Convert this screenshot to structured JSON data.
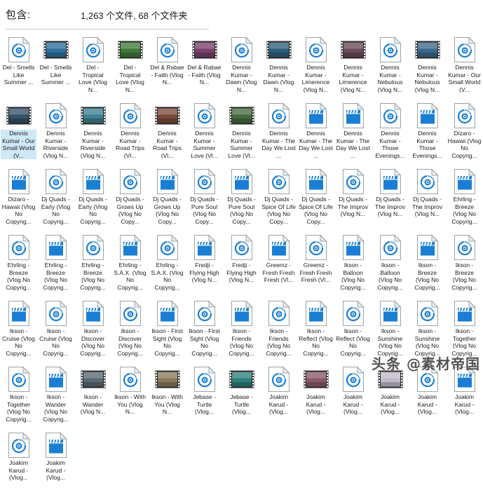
{
  "header": {
    "label": "包含:",
    "value": "1,263 个文件, 68 个文件夹"
  },
  "watermark": "头条 @素材帝国",
  "colors": {
    "accent": "#1a7fd4",
    "selection": "#cde8f7",
    "text": "#202020",
    "rule": "#c8c8c8"
  },
  "icons": {
    "audio": "audio-disc-file-icon",
    "video_thumb": "video-filmstrip-thumbnail-icon",
    "video_clapper": "video-clapperboard-file-icon"
  },
  "items": [
    {
      "name": "Del - Smells Like Summer ...",
      "icon": "audio",
      "selected": false
    },
    {
      "name": "Del - Smells Like Summer ...",
      "icon": "video_thumb",
      "thumb": "#2f6f9e",
      "selected": false
    },
    {
      "name": "Del - Tropical Love (Vlog N...",
      "icon": "audio",
      "selected": false
    },
    {
      "name": "Del - Tropical Love (Vlog N...",
      "icon": "video_thumb",
      "thumb": "#3f7a3a",
      "selected": false
    },
    {
      "name": "Del & Rabae - Faith (Vlog N...",
      "icon": "audio",
      "selected": false
    },
    {
      "name": "Del & Rabae - Faith (Vlog N...",
      "icon": "video_thumb",
      "thumb": "#7a3f6e",
      "selected": false
    },
    {
      "name": "Dennis Kumar - Dawn (Vlog N...",
      "icon": "audio",
      "selected": false
    },
    {
      "name": "Dennis Kumar - Dawn (Vlog N...",
      "icon": "video_thumb",
      "thumb": "#2d5f7a",
      "selected": false
    },
    {
      "name": "Dennis Kumar - Limerence (Vlog N...",
      "icon": "audio",
      "selected": false
    },
    {
      "name": "Dennis Kumar - Limerence (Vlog N...",
      "icon": "video_thumb",
      "thumb": "#6b4a5a",
      "selected": false
    },
    {
      "name": "Dennis Kumar - Nebulous (Vlog N...",
      "icon": "audio",
      "selected": false
    },
    {
      "name": "Dennis Kumar - Nebulous (Vlog N...",
      "icon": "video_thumb",
      "thumb": "#3a6a8a",
      "selected": false
    },
    {
      "name": "Dennis Kumar - Our Small World (V...",
      "icon": "audio",
      "selected": false
    },
    {
      "name": "Dennis Kumar - Our Small World (V...",
      "icon": "video_thumb",
      "thumb": "#35506b",
      "selected": true
    },
    {
      "name": "Dennis Kumar - Riverside (Vlog N...",
      "icon": "audio",
      "selected": false
    },
    {
      "name": "Dennis Kumar - Riverside (Vlog N...",
      "icon": "video_thumb",
      "thumb": "#3d7f93",
      "selected": false
    },
    {
      "name": "Dennis Kumar - Road Trips (Vl...",
      "icon": "audio",
      "selected": false
    },
    {
      "name": "Dennis Kumar - Road Trips (Vl...",
      "icon": "video_thumb",
      "thumb": "#7a4a38",
      "selected": false
    },
    {
      "name": "Dennis Kumar - Summer Love (Vl...",
      "icon": "audio",
      "selected": false
    },
    {
      "name": "Dennis Kumar - Summer Love (Vl...",
      "icon": "video_thumb",
      "thumb": "#456b3c",
      "selected": false
    },
    {
      "name": "Dennis Kumar - The Day We Lost ...",
      "icon": "audio",
      "selected": false
    },
    {
      "name": "Dennis Kumar - The Day We Lost ...",
      "icon": "video_clapper",
      "selected": false
    },
    {
      "name": "Dennis Kumar - The Day We Lost ...",
      "icon": "video_clapper",
      "selected": false
    },
    {
      "name": "Dennis Kumar - Those Evenings...",
      "icon": "audio",
      "selected": false
    },
    {
      "name": "Dennis Kumar - Those Evenings...",
      "icon": "video_clapper",
      "selected": false
    },
    {
      "name": "Dizaro - Hawaii (Vlog No Copyrig...",
      "icon": "audio",
      "selected": false
    },
    {
      "name": "Dizaro - Hawaii (Vlog No Copyrig...",
      "icon": "video_clapper",
      "selected": false
    },
    {
      "name": "Dj Quads - Early (Vlog No Copyrig...",
      "icon": "audio",
      "selected": false
    },
    {
      "name": "Dj Quads - Early (Vlog No Copyrig...",
      "icon": "video_clapper",
      "selected": false
    },
    {
      "name": "Dj Quads - Grows Up (Vlog No Copy...",
      "icon": "audio",
      "selected": false
    },
    {
      "name": "Dj Quads - Grows Up (Vlog No Copy...",
      "icon": "video_clapper",
      "selected": false
    },
    {
      "name": "Dj Quads - Pure Soul (Vlog No Copy...",
      "icon": "audio",
      "selected": false
    },
    {
      "name": "Dj Quads - Pure Soul (Vlog No Copy...",
      "icon": "video_clapper",
      "selected": false
    },
    {
      "name": "Dj Quads - Spice Of Life (Vlog No Copy...",
      "icon": "audio",
      "selected": false
    },
    {
      "name": "Dj Quads - Spice Of Life (Vlog No Copy...",
      "icon": "video_clapper",
      "selected": false
    },
    {
      "name": "Dj Quads - The Improv (Vlog N...",
      "icon": "audio",
      "selected": false
    },
    {
      "name": "Dj Quads - The Improv (Vlog N...",
      "icon": "video_clapper",
      "selected": false
    },
    {
      "name": "Dj Quads - The Improv (Vlog N...",
      "icon": "audio",
      "selected": false
    },
    {
      "name": "Ehrling - Breeze (Vlog No Copyrig...",
      "icon": "video_clapper",
      "selected": false
    },
    {
      "name": "Ehrling - Breeze (Vlog No Copyrig...",
      "icon": "audio",
      "selected": false
    },
    {
      "name": "Ehrling - Breeze (Vlog No Copyrig...",
      "icon": "video_clapper",
      "selected": false
    },
    {
      "name": "Ehrling - Breeze (Vlog No Copyrig...",
      "icon": "audio",
      "selected": false
    },
    {
      "name": "Ehrling - S.A.X. (Vlog No Copyrig...",
      "icon": "video_clapper",
      "selected": false
    },
    {
      "name": "Ehrling - S.A.X. (Vlog No Copyrig...",
      "icon": "audio",
      "selected": false
    },
    {
      "name": "Fredji - Flying High (Vlog N...",
      "icon": "video_clapper",
      "selected": false
    },
    {
      "name": "Fredji - Flying High (Vlog N...",
      "icon": "audio",
      "selected": false
    },
    {
      "name": "Greemz - Fresh Fresh Fresh (Vl...",
      "icon": "video_clapper",
      "selected": false
    },
    {
      "name": "Greemz - Fresh Fresh Fresh (Vl...",
      "icon": "audio",
      "selected": false
    },
    {
      "name": "Ikson - Balloon (Vlog No Copyrig...",
      "icon": "video_clapper",
      "selected": false
    },
    {
      "name": "Ikson - Balloon (Vlog No Copyrig...",
      "icon": "audio",
      "selected": false
    },
    {
      "name": "Ikson - Breeze (Vlog No Copyrig...",
      "icon": "video_clapper",
      "selected": false
    },
    {
      "name": "Ikson - Breeze (Vlog No Copyrig...",
      "icon": "audio",
      "selected": false
    },
    {
      "name": "Ikson - Cruise (Vlog No Copyrig...",
      "icon": "video_clapper",
      "selected": false
    },
    {
      "name": "Ikson - Cruise (Vlog No Copyrig...",
      "icon": "audio",
      "selected": false
    },
    {
      "name": "Ikson - Discover (Vlog No Copyrig...",
      "icon": "video_clapper",
      "selected": false
    },
    {
      "name": "Ikson - Discover (Vlog No Copyrig...",
      "icon": "audio",
      "selected": false
    },
    {
      "name": "Ikson - First Sight (Vlog No Copyrig...",
      "icon": "video_clapper",
      "selected": false
    },
    {
      "name": "Ikson - First Sight (Vlog No Copyrig...",
      "icon": "audio",
      "selected": false
    },
    {
      "name": "Ikson - Friends (Vlog No Copyrig...",
      "icon": "video_clapper",
      "selected": false
    },
    {
      "name": "Ikson - Friends (Vlog No Copyrig...",
      "icon": "audio",
      "selected": false
    },
    {
      "name": "Ikson - Reflect (Vlog No Copyrig...",
      "icon": "video_clapper",
      "selected": false
    },
    {
      "name": "Ikson - Reflect (Vlog No Copyrig...",
      "icon": "audio",
      "selected": false
    },
    {
      "name": "Ikson - Sunshine (Vlog No Copyrig...",
      "icon": "video_clapper",
      "selected": false
    },
    {
      "name": "Ikson - Sunshine (Vlog No Copyrig...",
      "icon": "audio",
      "selected": false
    },
    {
      "name": "Ikson - Together (Vlog No Copyrig...",
      "icon": "video_clapper",
      "selected": false
    },
    {
      "name": "Ikson - Together (Vlog No Copyrig...",
      "icon": "audio",
      "selected": false
    },
    {
      "name": "Ikson - Wander (Vlog No Copyrig...",
      "icon": "video_clapper",
      "selected": false
    },
    {
      "name": "Ikson - Wander (Vlog N...",
      "icon": "video_thumb",
      "thumb": "#5a6a72",
      "selected": false
    },
    {
      "name": "Ikson - With You (Vlog N...",
      "icon": "audio",
      "selected": false
    },
    {
      "name": "Ikson - With You (Vlog N...",
      "icon": "video_thumb",
      "thumb": "#8a7a5a",
      "selected": false
    },
    {
      "name": "Jebase - Turtle (Vlog...",
      "icon": "audio",
      "selected": false
    },
    {
      "name": "Jebase - Turtle (Vlog...",
      "icon": "video_thumb",
      "thumb": "#2e7f7a",
      "selected": false
    },
    {
      "name": "Joakim Karud - (Vlog...",
      "icon": "audio",
      "selected": false
    },
    {
      "name": "Joakim Karud - (Vlog...",
      "icon": "video_thumb",
      "thumb": "#8a5a6a",
      "selected": false
    },
    {
      "name": "Joakim Karud - (Vlog...",
      "icon": "audio",
      "selected": false
    },
    {
      "name": "Joakim Karud - (Vlog...",
      "icon": "video_thumb",
      "thumb": "#c0b8c8",
      "selected": false
    },
    {
      "name": "Joakim Karud - (Vlog...",
      "icon": "audio",
      "selected": false
    },
    {
      "name": "Joakim Karud - (Vlog...",
      "icon": "video_clapper",
      "selected": false
    },
    {
      "name": "Joakim Karud - (Vlog...",
      "icon": "audio",
      "selected": false
    },
    {
      "name": "Joakim Karud - (Vlog...",
      "icon": "video_clapper",
      "selected": false
    }
  ]
}
